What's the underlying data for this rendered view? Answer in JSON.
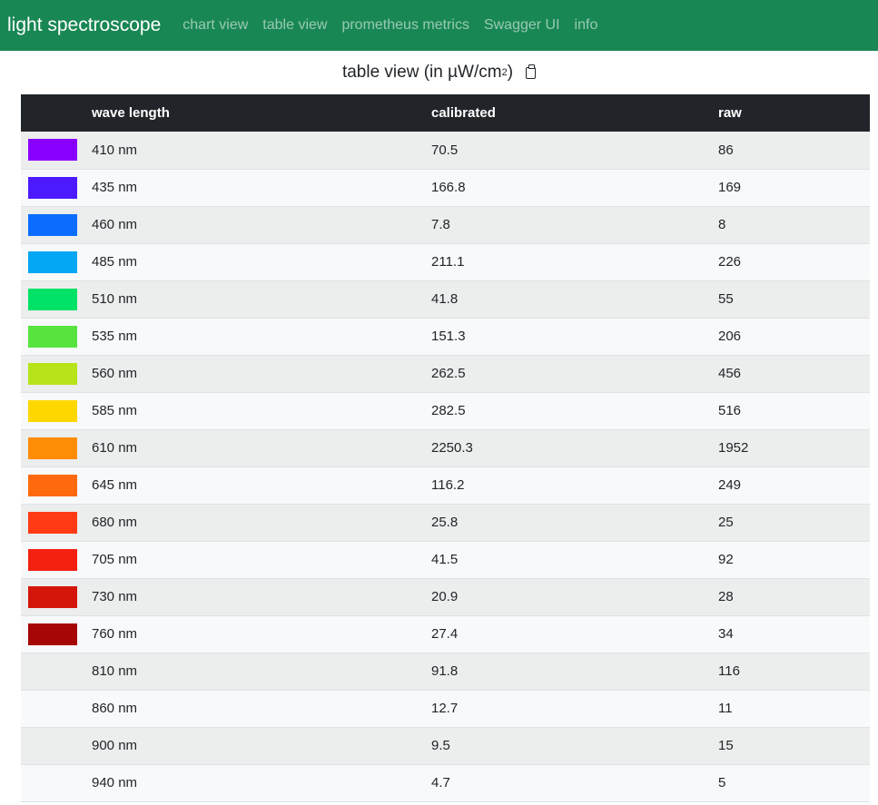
{
  "nav": {
    "brand": "light spectroscope",
    "links": [
      "chart view",
      "table view",
      "prometheus metrics",
      "Swagger UI",
      "info"
    ]
  },
  "heading": {
    "text": "table view (in µW/cm",
    "superscript": "2",
    "suffix": ")"
  },
  "table": {
    "columns": [
      "",
      "wave length",
      "calibrated",
      "raw"
    ],
    "rows": [
      {
        "color": "#8a00ff",
        "wavelength": "410 nm",
        "calibrated": "70.5",
        "raw": "86"
      },
      {
        "color": "#4c1aff",
        "wavelength": "435 nm",
        "calibrated": "166.8",
        "raw": "169"
      },
      {
        "color": "#0a6dff",
        "wavelength": "460 nm",
        "calibrated": "7.8",
        "raw": "8"
      },
      {
        "color": "#03a7f3",
        "wavelength": "485 nm",
        "calibrated": "211.1",
        "raw": "226"
      },
      {
        "color": "#00e266",
        "wavelength": "510 nm",
        "calibrated": "41.8",
        "raw": "55"
      },
      {
        "color": "#57e43f",
        "wavelength": "535 nm",
        "calibrated": "151.3",
        "raw": "206"
      },
      {
        "color": "#b6e418",
        "wavelength": "560 nm",
        "calibrated": "262.5",
        "raw": "456"
      },
      {
        "color": "#ffd700",
        "wavelength": "585 nm",
        "calibrated": "282.5",
        "raw": "516"
      },
      {
        "color": "#ff8c05",
        "wavelength": "610 nm",
        "calibrated": "2250.3",
        "raw": "1952"
      },
      {
        "color": "#ff6a0f",
        "wavelength": "645 nm",
        "calibrated": "116.2",
        "raw": "249"
      },
      {
        "color": "#ff3a14",
        "wavelength": "680 nm",
        "calibrated": "25.8",
        "raw": "25"
      },
      {
        "color": "#f42010",
        "wavelength": "705 nm",
        "calibrated": "41.5",
        "raw": "92"
      },
      {
        "color": "#d41509",
        "wavelength": "730 nm",
        "calibrated": "20.9",
        "raw": "28"
      },
      {
        "color": "#a60606",
        "wavelength": "760 nm",
        "calibrated": "27.4",
        "raw": "34"
      },
      {
        "color": "",
        "wavelength": "810 nm",
        "calibrated": "91.8",
        "raw": "116"
      },
      {
        "color": "",
        "wavelength": "860 nm",
        "calibrated": "12.7",
        "raw": "11"
      },
      {
        "color": "",
        "wavelength": "900 nm",
        "calibrated": "9.5",
        "raw": "15"
      },
      {
        "color": "",
        "wavelength": "940 nm",
        "calibrated": "4.7",
        "raw": "5"
      }
    ]
  }
}
